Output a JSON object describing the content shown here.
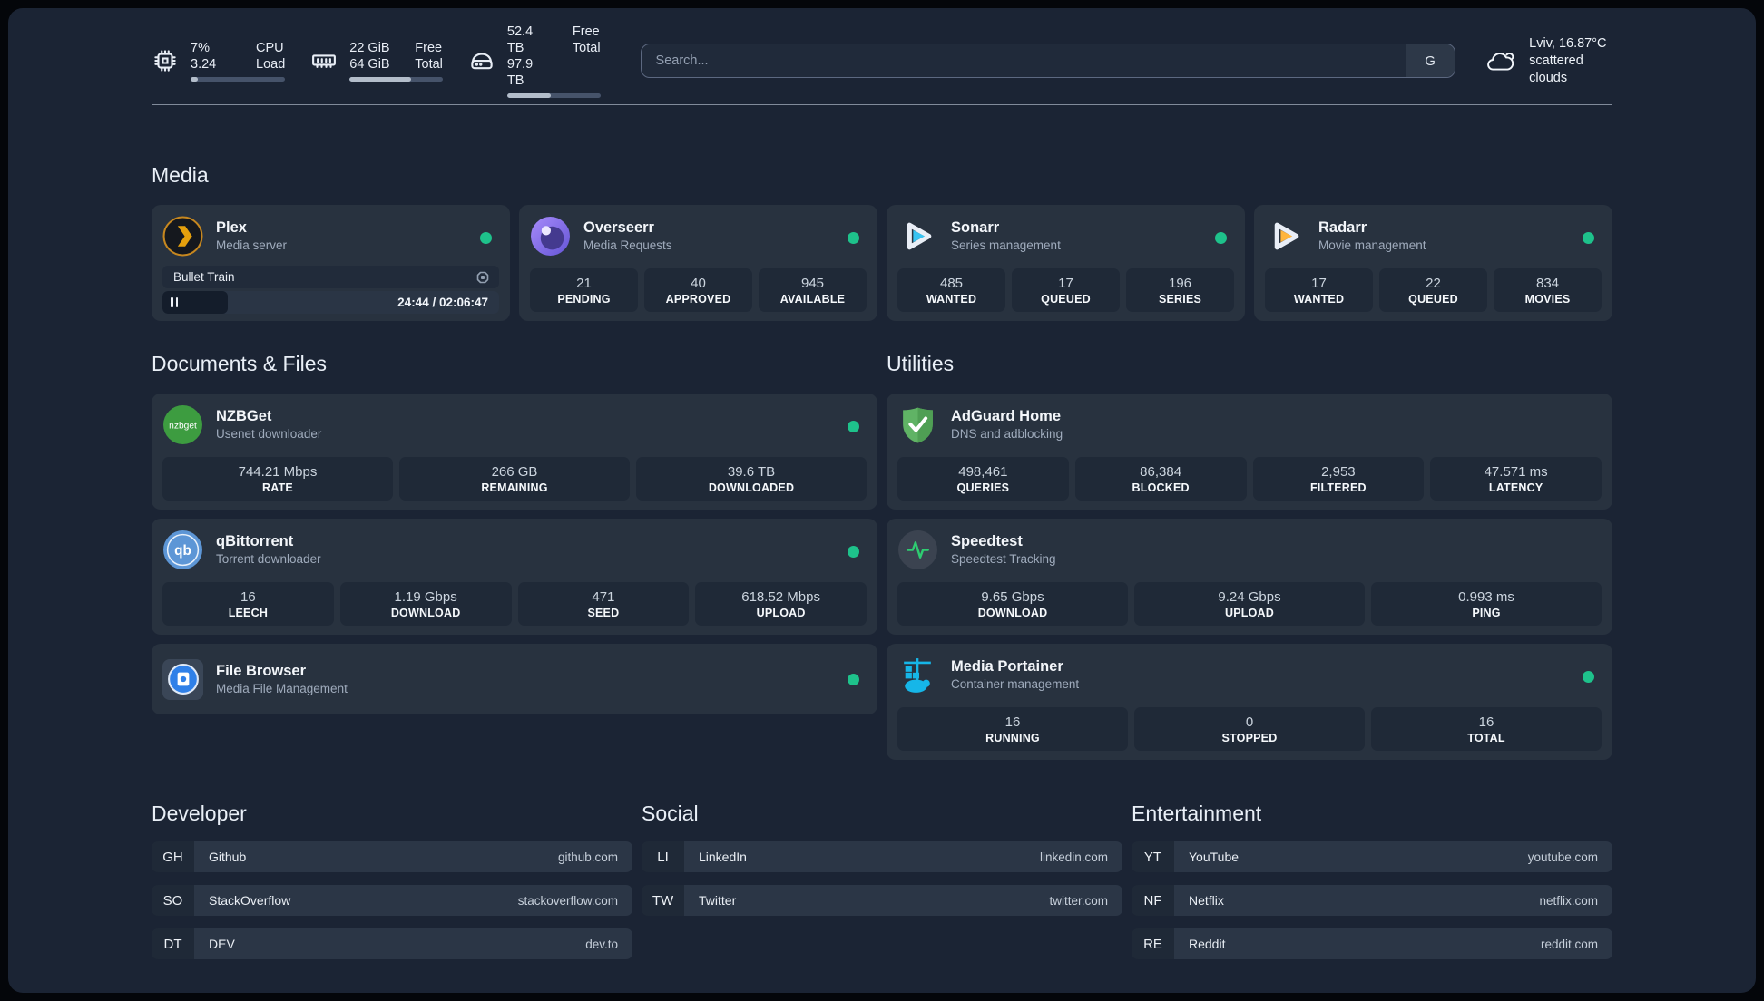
{
  "header": {
    "stats": [
      {
        "icon": "cpu-icon",
        "values": [
          "7%",
          "3.24"
        ],
        "labels": [
          "CPU",
          "Load"
        ],
        "progress_pct": 8
      },
      {
        "icon": "memory-icon",
        "values": [
          "22 GiB",
          "64 GiB"
        ],
        "labels": [
          "Free",
          "Total"
        ],
        "progress_pct": 66
      },
      {
        "icon": "disk-icon",
        "values": [
          "52.4 TB",
          "97.9 TB"
        ],
        "labels": [
          "Free",
          "Total"
        ],
        "progress_pct": 47
      }
    ],
    "search": {
      "placeholder": "Search...",
      "button": "G"
    },
    "weather": {
      "location": "Lviv, 16.87°C",
      "condition": "scattered clouds"
    }
  },
  "sections": {
    "media": {
      "title": "Media",
      "cards": {
        "plex": {
          "name": "Plex",
          "subtitle": "Media server",
          "player": {
            "title": "Bullet Train",
            "time": "24:44 / 02:06:47",
            "progress_pct": 19.5
          }
        },
        "overseerr": {
          "name": "Overseerr",
          "subtitle": "Media Requests",
          "stats": [
            {
              "value": "21",
              "label": "PENDING"
            },
            {
              "value": "40",
              "label": "APPROVED"
            },
            {
              "value": "945",
              "label": "AVAILABLE"
            }
          ]
        },
        "sonarr": {
          "name": "Sonarr",
          "subtitle": "Series management",
          "stats": [
            {
              "value": "485",
              "label": "WANTED"
            },
            {
              "value": "17",
              "label": "QUEUED"
            },
            {
              "value": "196",
              "label": "SERIES"
            }
          ]
        },
        "radarr": {
          "name": "Radarr",
          "subtitle": "Movie management",
          "stats": [
            {
              "value": "17",
              "label": "WANTED"
            },
            {
              "value": "22",
              "label": "QUEUED"
            },
            {
              "value": "834",
              "label": "MOVIES"
            }
          ]
        }
      }
    },
    "documents": {
      "title": "Documents & Files",
      "cards": {
        "nzbget": {
          "name": "NZBGet",
          "subtitle": "Usenet downloader",
          "stats": [
            {
              "value": "744.21 Mbps",
              "label": "RATE"
            },
            {
              "value": "266 GB",
              "label": "REMAINING"
            },
            {
              "value": "39.6 TB",
              "label": "DOWNLOADED"
            }
          ]
        },
        "qbittorrent": {
          "name": "qBittorrent",
          "subtitle": "Torrent downloader",
          "stats": [
            {
              "value": "16",
              "label": "LEECH"
            },
            {
              "value": "1.19 Gbps",
              "label": "DOWNLOAD"
            },
            {
              "value": "471",
              "label": "SEED"
            },
            {
              "value": "618.52 Mbps",
              "label": "UPLOAD"
            }
          ]
        },
        "filebrowser": {
          "name": "File Browser",
          "subtitle": "Media File Management"
        }
      }
    },
    "utilities": {
      "title": "Utilities",
      "cards": {
        "adguard": {
          "name": "AdGuard Home",
          "subtitle": "DNS and adblocking",
          "stats": [
            {
              "value": "498,461",
              "label": "QUERIES"
            },
            {
              "value": "86,384",
              "label": "BLOCKED"
            },
            {
              "value": "2,953",
              "label": "FILTERED"
            },
            {
              "value": "47.571 ms",
              "label": "LATENCY"
            }
          ]
        },
        "speedtest": {
          "name": "Speedtest",
          "subtitle": "Speedtest Tracking",
          "stats": [
            {
              "value": "9.65 Gbps",
              "label": "DOWNLOAD"
            },
            {
              "value": "9.24 Gbps",
              "label": "UPLOAD"
            },
            {
              "value": "0.993 ms",
              "label": "PING"
            }
          ]
        },
        "portainer": {
          "name": "Media Portainer",
          "subtitle": "Container management",
          "stats": [
            {
              "value": "16",
              "label": "RUNNING"
            },
            {
              "value": "0",
              "label": "STOPPED"
            },
            {
              "value": "16",
              "label": "TOTAL"
            }
          ]
        }
      }
    }
  },
  "links": {
    "developer": {
      "title": "Developer",
      "items": [
        {
          "abbr": "GH",
          "name": "Github",
          "url": "github.com"
        },
        {
          "abbr": "SO",
          "name": "StackOverflow",
          "url": "stackoverflow.com"
        },
        {
          "abbr": "DT",
          "name": "DEV",
          "url": "dev.to"
        }
      ]
    },
    "social": {
      "title": "Social",
      "items": [
        {
          "abbr": "LI",
          "name": "LinkedIn",
          "url": "linkedin.com"
        },
        {
          "abbr": "TW",
          "name": "Twitter",
          "url": "twitter.com"
        }
      ]
    },
    "entertainment": {
      "title": "Entertainment",
      "items": [
        {
          "abbr": "YT",
          "name": "YouTube",
          "url": "youtube.com"
        },
        {
          "abbr": "NF",
          "name": "Netflix",
          "url": "netflix.com"
        },
        {
          "abbr": "RE",
          "name": "Reddit",
          "url": "reddit.com"
        }
      ]
    }
  },
  "colors": {
    "status_online": "#1ec28b",
    "plex_accent": "#e5a00d",
    "sonarr_accent": "#36c3f2",
    "radarr_accent": "#ffb53c"
  }
}
